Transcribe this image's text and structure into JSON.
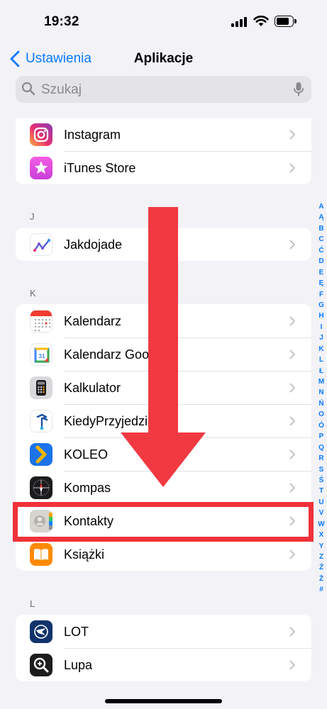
{
  "status_bar": {
    "time": "19:32"
  },
  "nav": {
    "back_label": "Ustawienia",
    "title": "Aplikacje"
  },
  "search": {
    "placeholder": "Szukaj",
    "value": ""
  },
  "groups": {
    "top": {
      "items": [
        {
          "label": "Instagram",
          "icon": "instagram-icon"
        },
        {
          "label": "iTunes Store",
          "icon": "itunes-store-icon"
        }
      ]
    },
    "j": {
      "header": "J",
      "items": [
        {
          "label": "Jakdojade",
          "icon": "jakdojade-icon"
        }
      ]
    },
    "k": {
      "header": "K",
      "items": [
        {
          "label": "Kalendarz",
          "icon": "calendar-icon"
        },
        {
          "label": "Kalendarz Goo",
          "icon": "google-calendar-icon"
        },
        {
          "label": "Kalkulator",
          "icon": "calculator-icon"
        },
        {
          "label": "KiedyPrzyjedzi",
          "icon": "kiedyprzyjedzie-icon"
        },
        {
          "label": "KOLEO",
          "icon": "koleo-icon"
        },
        {
          "label": "Kompas",
          "icon": "compass-icon"
        },
        {
          "label": "Kontakty",
          "icon": "contacts-icon"
        },
        {
          "label": "Książki",
          "icon": "books-icon"
        }
      ]
    },
    "l": {
      "header": "L",
      "items": [
        {
          "label": "LOT",
          "icon": "lot-icon"
        },
        {
          "label": "Lupa",
          "icon": "magnifier-icon"
        }
      ]
    }
  },
  "index": [
    "A",
    "Ą",
    "B",
    "C",
    "Ć",
    "D",
    "E",
    "Ę",
    "F",
    "G",
    "H",
    "I",
    "J",
    "K",
    "L",
    "Ł",
    "M",
    "N",
    "Ń",
    "O",
    "Ó",
    "P",
    "Q",
    "R",
    "S",
    "Ś",
    "T",
    "U",
    "V",
    "W",
    "X",
    "Y",
    "Z",
    "Ź",
    "Ż",
    "#"
  ],
  "colors": {
    "accent": "#0a7aff",
    "annotation_red": "#f0313a",
    "background": "#f2f2f7"
  }
}
